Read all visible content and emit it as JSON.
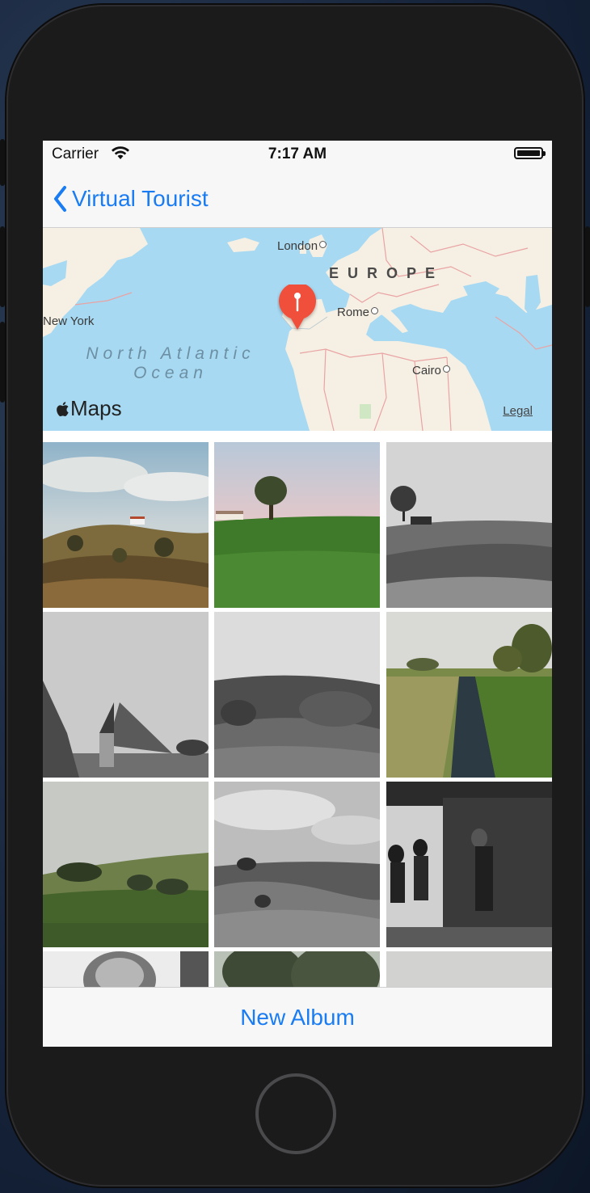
{
  "status_bar": {
    "carrier": "Carrier",
    "time": "7:17 AM"
  },
  "nav": {
    "back_label": "Virtual Tourist"
  },
  "map": {
    "labels": {
      "london": "London",
      "europe": "EUROPE",
      "rome": "Rome",
      "new_york": "New York",
      "ocean_line1": "North Atlantic",
      "ocean_line2": "Ocean",
      "cairo": "Cairo"
    },
    "brand": "Maps",
    "legal": "Legal",
    "pin_color": "#f0503a"
  },
  "photos": [
    {
      "name": "photo-hills-farmhouse",
      "tone": "color"
    },
    {
      "name": "photo-tree-green-field",
      "tone": "color"
    },
    {
      "name": "photo-bw-farm-hill",
      "tone": "grayscale"
    },
    {
      "name": "photo-bw-thatched-huts",
      "tone": "grayscale"
    },
    {
      "name": "photo-bw-rolling-field",
      "tone": "grayscale"
    },
    {
      "name": "photo-stream-grass",
      "tone": "color"
    },
    {
      "name": "photo-misty-green-hill",
      "tone": "color"
    },
    {
      "name": "photo-bw-cloudy-hills",
      "tone": "grayscale"
    },
    {
      "name": "photo-bw-workshop-children",
      "tone": "grayscale"
    },
    {
      "name": "photo-bw-portrait",
      "tone": "grayscale"
    },
    {
      "name": "photo-trees",
      "tone": "color"
    },
    {
      "name": "photo-blank-gray",
      "tone": "grayscale"
    }
  ],
  "toolbar": {
    "new_album_label": "New Album"
  },
  "colors": {
    "accent": "#1a7cf2",
    "bar_background": "#f7f7f7",
    "map_water": "#a7d9f2",
    "map_land": "#f6f0e4"
  }
}
